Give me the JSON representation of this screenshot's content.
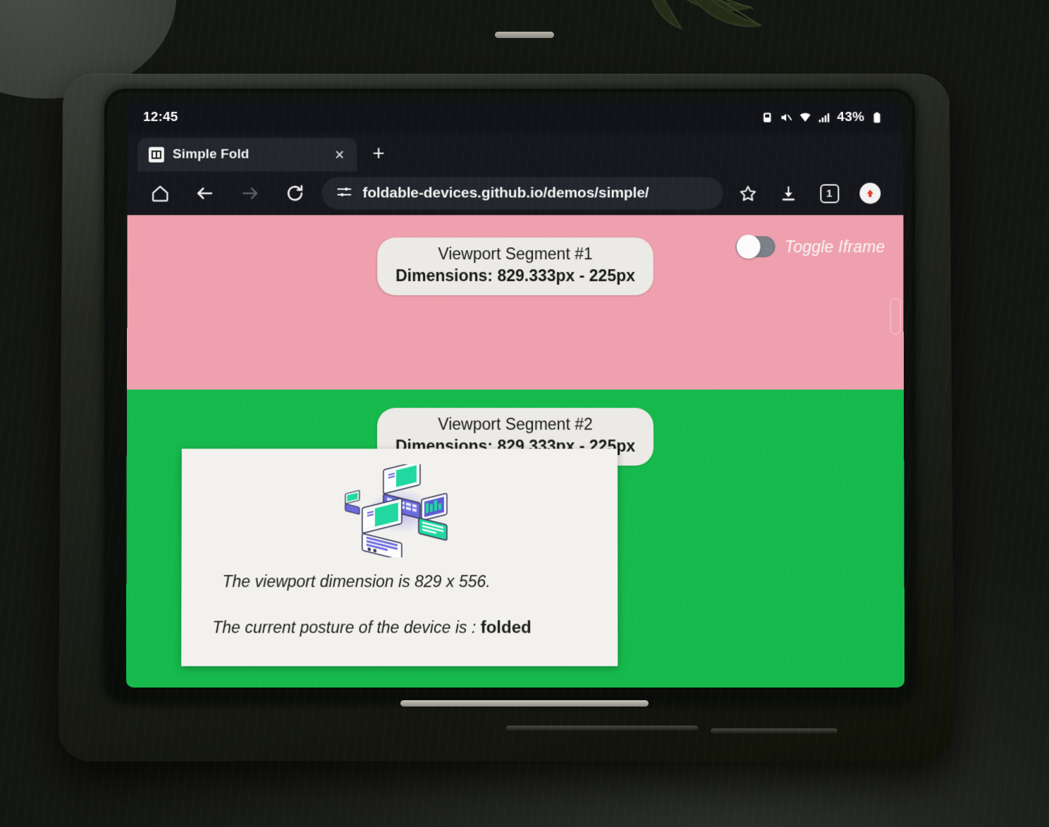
{
  "status_bar": {
    "time": "12:45",
    "battery_percent": "43%",
    "icons": [
      "screenshot-icon",
      "mute-icon",
      "wifi-icon",
      "signal-icon",
      "battery-icon"
    ]
  },
  "browser": {
    "tab": {
      "title": "Simple Fold",
      "favicon_name": "simple-fold-favicon",
      "close_label": "×"
    },
    "new_tab_label": "+",
    "toolbar": {
      "home_icon": "home-icon",
      "back_icon": "back-arrow-icon",
      "forward_icon": "forward-arrow-icon",
      "reload_icon": "reload-icon",
      "site_info_icon": "tune-icon",
      "url": "foldable-devices.github.io/demos/simple/",
      "bookmark_icon": "star-icon",
      "download_icon": "download-icon",
      "tab_count": "1",
      "profile_icon": "profile-icon"
    }
  },
  "page": {
    "toggle": {
      "label": "Toggle Iframe",
      "state": "off"
    },
    "segments": [
      {
        "title": "Viewport Segment #1",
        "dimensions": "Dimensions: 829.333px - 225px",
        "color": "#efa0ae"
      },
      {
        "title": "Viewport Segment #2",
        "dimensions": "Dimensions: 829.333px - 225px",
        "color": "#16b94c"
      }
    ],
    "info_card": {
      "illustration_name": "foldable-devices-illustration",
      "viewport_line": "The viewport dimension is 829 x 556.",
      "posture_prefix": "The current posture of the device is : ",
      "posture_value": "folded"
    }
  },
  "colors": {
    "segment_1_pink": "#efa0ae",
    "segment_2_green": "#16b94c",
    "card_background": "#f2f1ed",
    "chrome_dark": "#15171c",
    "chrome_surface": "#23262c"
  }
}
